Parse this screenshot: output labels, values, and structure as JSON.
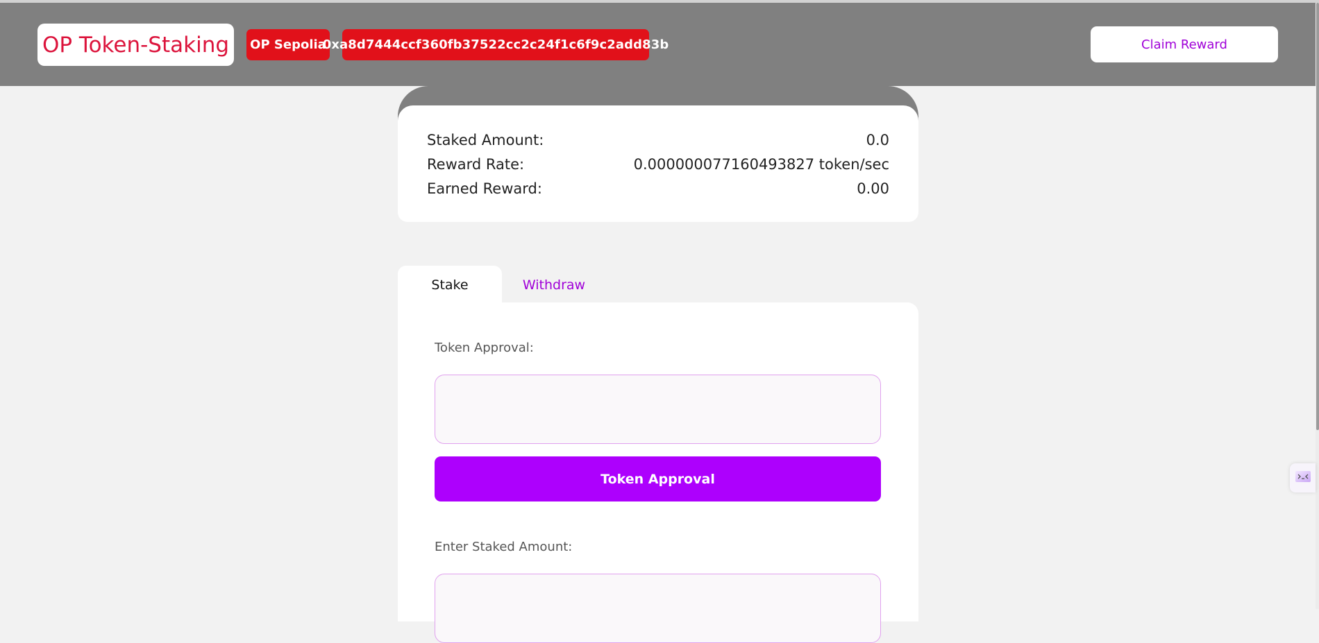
{
  "header": {
    "brand": "OP Token-Staking",
    "network": "OP Sepolia",
    "address": "0xa8d7444ccf360fb37522cc2c24f1c6f9c2add83b",
    "claim_label": "Claim Reward"
  },
  "stats": {
    "staked_label": "Staked Amount:",
    "staked_value": "0.0",
    "rate_label": "Reward Rate:",
    "rate_value": "0.000000077160493827 token/sec",
    "earned_label": "Earned Reward:",
    "earned_value": "0.00"
  },
  "tabs": {
    "stake": "Stake",
    "withdraw": "Withdraw",
    "active": "stake"
  },
  "form": {
    "approval_label": "Token Approval:",
    "approval_value": "",
    "approval_button": "Token Approval",
    "staked_label": "Enter Staked Amount:",
    "staked_value": ""
  },
  "floating_widget": {
    "icon": "expand-icon"
  },
  "colors": {
    "header_bg": "#808080",
    "brand_text": "#dc143c",
    "pill_bg": "#e1111a",
    "accent": "#ad00fd",
    "page_bg": "#f2f2f2"
  }
}
